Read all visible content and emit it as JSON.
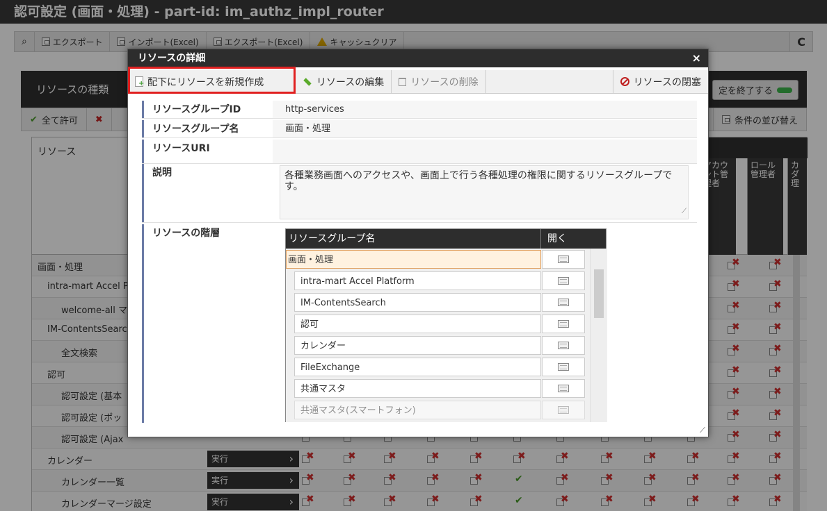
{
  "window": {
    "title": "認可設定 (画面・処理) - part-id: im_authz_impl_router"
  },
  "toolbar": {
    "search_icon": "search-icon",
    "buttons": [
      "エクスポート",
      "インポート(Excel)",
      "エクスポート(Excel)",
      "キャッシュクリア"
    ],
    "refresh_icon": "refresh-icon"
  },
  "panel": {
    "title": "リソースの種類",
    "end_button": "定を終了する"
  },
  "actions": {
    "allow_all": "全て許可",
    "reorder": "条件の並び替え"
  },
  "grid": {
    "header_label": "リソース",
    "role_columns": [
      "アカウ\nント管\n理者",
      "ロール\n管理者",
      "カ\nダ\n理"
    ]
  },
  "tree": [
    {
      "label": "画面・処理",
      "indent": 0
    },
    {
      "label": "intra-mart Accel P",
      "indent": 1
    },
    {
      "label": "welcome-all マ",
      "indent": 2
    },
    {
      "label": "IM-ContentsSearc",
      "indent": 1
    },
    {
      "label": "全文検索",
      "indent": 2
    },
    {
      "label": "認可",
      "indent": 1
    },
    {
      "label": "認可設定 (基本",
      "indent": 2
    },
    {
      "label": "認可設定 (ポッ",
      "indent": 2
    },
    {
      "label": "認可設定 (Ajax",
      "indent": 2
    },
    {
      "label": "カレンダー",
      "indent": 1,
      "exec": "実行"
    },
    {
      "label": "カレンダー一覧",
      "indent": 2,
      "exec": "実行",
      "ok": true
    },
    {
      "label": "カレンダーマージ設定",
      "indent": 2,
      "exec": "実行",
      "ok": true
    }
  ],
  "dialog": {
    "title": "リソースの詳細",
    "close": "×",
    "buttons": {
      "create_child": "配下にリソースを新規作成",
      "edit": "リソースの編集",
      "delete": "リソースの削除",
      "close_resource": "リソースの閉塞"
    },
    "fields": {
      "group_id_label": "リソースグループID",
      "group_id_value": "http-services",
      "group_name_label": "リソースグループ名",
      "group_name_value": "画面・処理",
      "uri_label": "リソースURI",
      "uri_value": "",
      "description_label": "説明",
      "description_value": "各種業務画面へのアクセスや、画面上で行う各種処理の権限に関するリソースグループです。",
      "hierarchy_label": "リソースの階層"
    },
    "hierarchy": {
      "col_name": "リソースグループ名",
      "col_open": "開く",
      "rows": [
        {
          "name": "画面・処理",
          "level": 0,
          "selected": true
        },
        {
          "name": "intra-mart Accel Platform",
          "level": 1
        },
        {
          "name": "IM-ContentsSearch",
          "level": 1
        },
        {
          "name": "認可",
          "level": 1
        },
        {
          "name": "カレンダー",
          "level": 1
        },
        {
          "name": "FileExchange",
          "level": 1
        },
        {
          "name": "共通マスタ",
          "level": 1
        },
        {
          "name": "共通マスタ(スマートフォン)",
          "level": 1,
          "faded": true
        }
      ]
    }
  }
}
